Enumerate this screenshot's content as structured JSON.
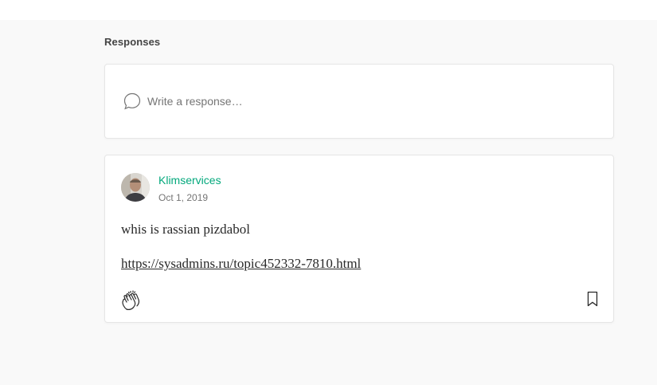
{
  "responses": {
    "title": "Responses",
    "write_placeholder": "Write a response…",
    "items": [
      {
        "author": "Klimservices",
        "date": "Oct 1, 2019",
        "text": "whis is rassian pizdabol",
        "link": "https://sysadmins.ru/topic452332-7810.html"
      }
    ]
  },
  "icons": {
    "write": "speech-bubble-icon",
    "clap": "clap-icon",
    "bookmark": "bookmark-icon"
  },
  "colors": {
    "author": "#03a87c",
    "background": "#f9f9f9",
    "card_border": "#e6e6e6"
  }
}
